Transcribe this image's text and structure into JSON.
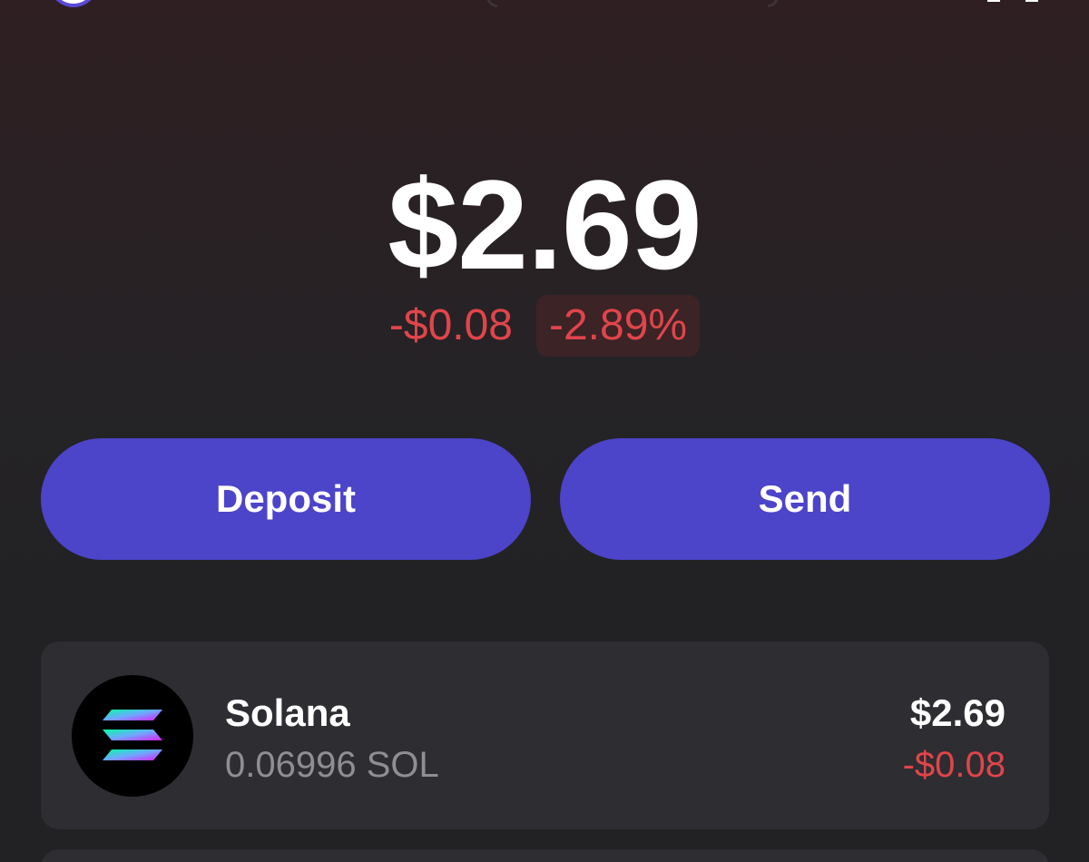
{
  "balance": {
    "total": "$2.69",
    "change_amount": "-$0.08",
    "change_percent": "-2.89%"
  },
  "actions": {
    "deposit_label": "Deposit",
    "send_label": "Send"
  },
  "tokens": [
    {
      "name": "Solana",
      "amount": "0.06996 SOL",
      "value": "$2.69",
      "change": "-$0.08",
      "icon": "solana-icon"
    }
  ],
  "colors": {
    "accent": "#4c44c9",
    "negative": "#e0454a",
    "card": "#2d2d32",
    "muted_text": "#8e8e93"
  }
}
